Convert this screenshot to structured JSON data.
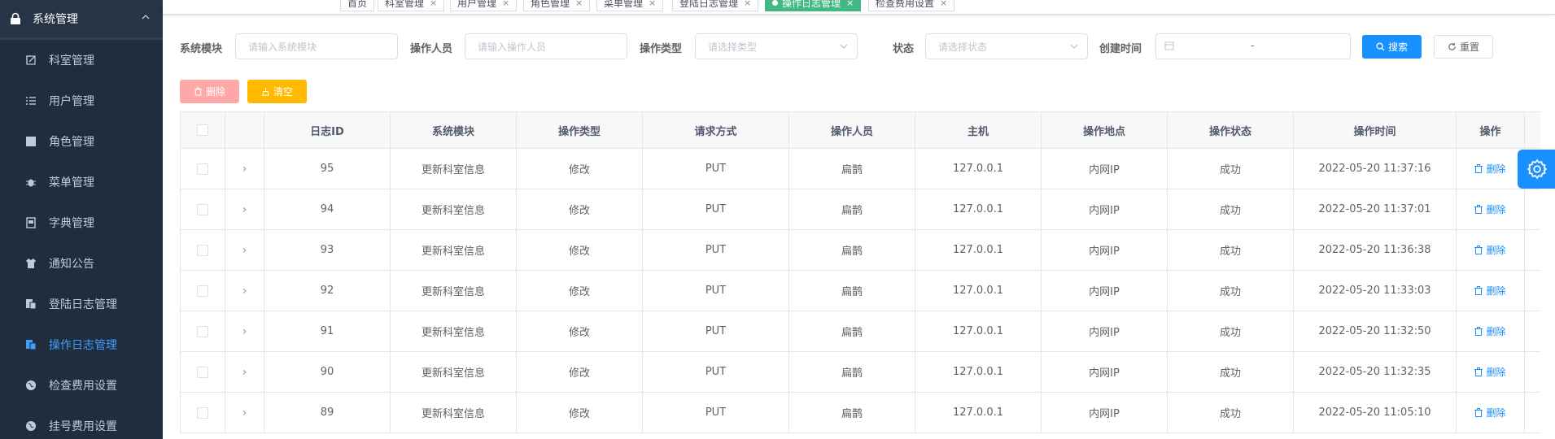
{
  "sidebar": {
    "header": {
      "label": "系统管理",
      "icon": "lock-icon"
    },
    "items": [
      {
        "label": "科室管理",
        "icon": "edit-icon"
      },
      {
        "label": "用户管理",
        "icon": "list-icon"
      },
      {
        "label": "角色管理",
        "icon": "clapperboard-icon"
      },
      {
        "label": "菜单管理",
        "icon": "bug-icon"
      },
      {
        "label": "字典管理",
        "icon": "dictionary-icon"
      },
      {
        "label": "通知公告",
        "icon": "shirt-icon"
      },
      {
        "label": "登陆日志管理",
        "icon": "log-icon"
      },
      {
        "label": "操作日志管理",
        "icon": "log-icon"
      },
      {
        "label": "检查费用设置",
        "icon": "globe-icon"
      },
      {
        "label": "挂号费用设置",
        "icon": "globe-icon"
      }
    ],
    "active_index": 7
  },
  "tags": [
    {
      "label": "首页",
      "closable": false
    },
    {
      "label": "科室管理",
      "closable": true
    },
    {
      "label": "用户管理",
      "closable": true
    },
    {
      "label": "角色管理",
      "closable": true
    },
    {
      "label": "菜单管理",
      "closable": true
    },
    {
      "label": "登陆日志管理",
      "closable": true
    },
    {
      "label": "操作日志管理",
      "closable": true,
      "active": true
    },
    {
      "label": "检查费用设置",
      "closable": true
    }
  ],
  "search": {
    "module_label": "系统模块",
    "module_placeholder": "请输入系统模块",
    "operator_label": "操作人员",
    "operator_placeholder": "请输入操作人员",
    "type_label": "操作类型",
    "type_placeholder": "请选择类型",
    "status_label": "状态",
    "status_placeholder": "请选择状态",
    "time_label": "创建时间",
    "time_separator": "-",
    "search_button": "搜索",
    "reset_button": "重置"
  },
  "toolbar": {
    "delete_button": "删除",
    "clear_button": "清空"
  },
  "table": {
    "columns": [
      "日志ID",
      "系统模块",
      "操作类型",
      "请求方式",
      "操作人员",
      "主机",
      "操作地点",
      "操作状态",
      "操作时间",
      "操作"
    ],
    "delete_label": "删除",
    "rows": [
      [
        "95",
        "更新科室信息",
        "修改",
        "PUT",
        "扁鹊",
        "127.0.0.1",
        "内网IP",
        "成功",
        "2022-05-20 11:37:16"
      ],
      [
        "94",
        "更新科室信息",
        "修改",
        "PUT",
        "扁鹊",
        "127.0.0.1",
        "内网IP",
        "成功",
        "2022-05-20 11:37:01"
      ],
      [
        "93",
        "更新科室信息",
        "修改",
        "PUT",
        "扁鹊",
        "127.0.0.1",
        "内网IP",
        "成功",
        "2022-05-20 11:36:38"
      ],
      [
        "92",
        "更新科室信息",
        "修改",
        "PUT",
        "扁鹊",
        "127.0.0.1",
        "内网IP",
        "成功",
        "2022-05-20 11:33:03"
      ],
      [
        "91",
        "更新科室信息",
        "修改",
        "PUT",
        "扁鹊",
        "127.0.0.1",
        "内网IP",
        "成功",
        "2022-05-20 11:32:50"
      ],
      [
        "90",
        "更新科室信息",
        "修改",
        "PUT",
        "扁鹊",
        "127.0.0.1",
        "内网IP",
        "成功",
        "2022-05-20 11:32:35"
      ],
      [
        "89",
        "更新科室信息",
        "修改",
        "PUT",
        "扁鹊",
        "127.0.0.1",
        "内网IP",
        "成功",
        "2022-05-20 11:05:10"
      ]
    ]
  },
  "colors": {
    "sidebar_bg": "#304156",
    "sidebar_item_bg": "#1f2d3d",
    "active_tag": "#42b983",
    "primary": "#1890ff",
    "danger_light": "#ffa8a8",
    "warning": "#ffba00"
  }
}
